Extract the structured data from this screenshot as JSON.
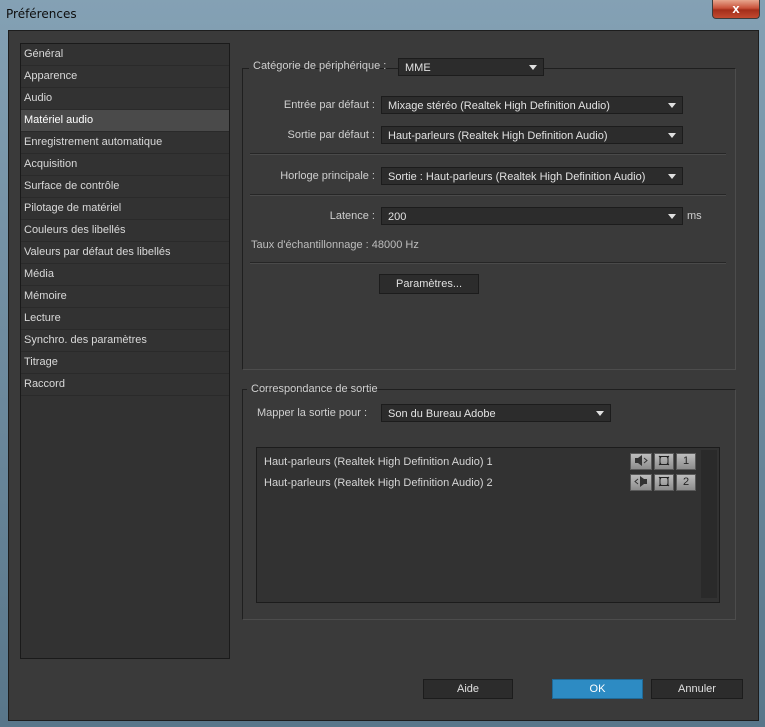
{
  "window": {
    "title": "Préférences",
    "close_glyph": "x"
  },
  "sidebar": {
    "items": [
      {
        "label": "Général"
      },
      {
        "label": "Apparence"
      },
      {
        "label": "Audio"
      },
      {
        "label": "Matériel audio",
        "active": true
      },
      {
        "label": "Enregistrement automatique"
      },
      {
        "label": "Acquisition"
      },
      {
        "label": "Surface de contrôle"
      },
      {
        "label": "Pilotage de matériel"
      },
      {
        "label": "Couleurs des libellés"
      },
      {
        "label": "Valeurs par défaut des libellés"
      },
      {
        "label": "Média"
      },
      {
        "label": "Mémoire"
      },
      {
        "label": "Lecture"
      },
      {
        "label": "Synchro. des paramètres"
      },
      {
        "label": "Titrage"
      },
      {
        "label": "Raccord"
      }
    ]
  },
  "device": {
    "category_label": "Catégorie de périphérique :",
    "category_value": "MME",
    "input_label": "Entrée par défaut :",
    "input_value": "Mixage stéréo (Realtek High Definition Audio)",
    "output_label": "Sortie par défaut :",
    "output_value": "Haut-parleurs (Realtek High Definition Audio)",
    "clock_label": "Horloge principale :",
    "clock_value": "Sortie : Haut-parleurs (Realtek High Definition Audio)",
    "latency_label": "Latence :",
    "latency_value": "200",
    "latency_unit": "ms",
    "sample_rate_text": "Taux d'échantillonnage : 48000 Hz",
    "settings_button": "Paramètres..."
  },
  "output_mapping": {
    "group_label": "Correspondance de sortie",
    "map_label": "Mapper la sortie pour :",
    "map_value": "Son du Bureau Adobe",
    "rows": [
      {
        "label": "Haut-parleurs (Realtek High Definition Audio) 1",
        "channel": "1"
      },
      {
        "label": "Haut-parleurs (Realtek High Definition Audio) 2",
        "channel": "2"
      }
    ]
  },
  "footer": {
    "help": "Aide",
    "ok": "OK",
    "cancel": "Annuler"
  },
  "colors": {
    "accent": "#2d8bc3",
    "panel": "#3a3a3a",
    "field": "#2c2c2c"
  }
}
